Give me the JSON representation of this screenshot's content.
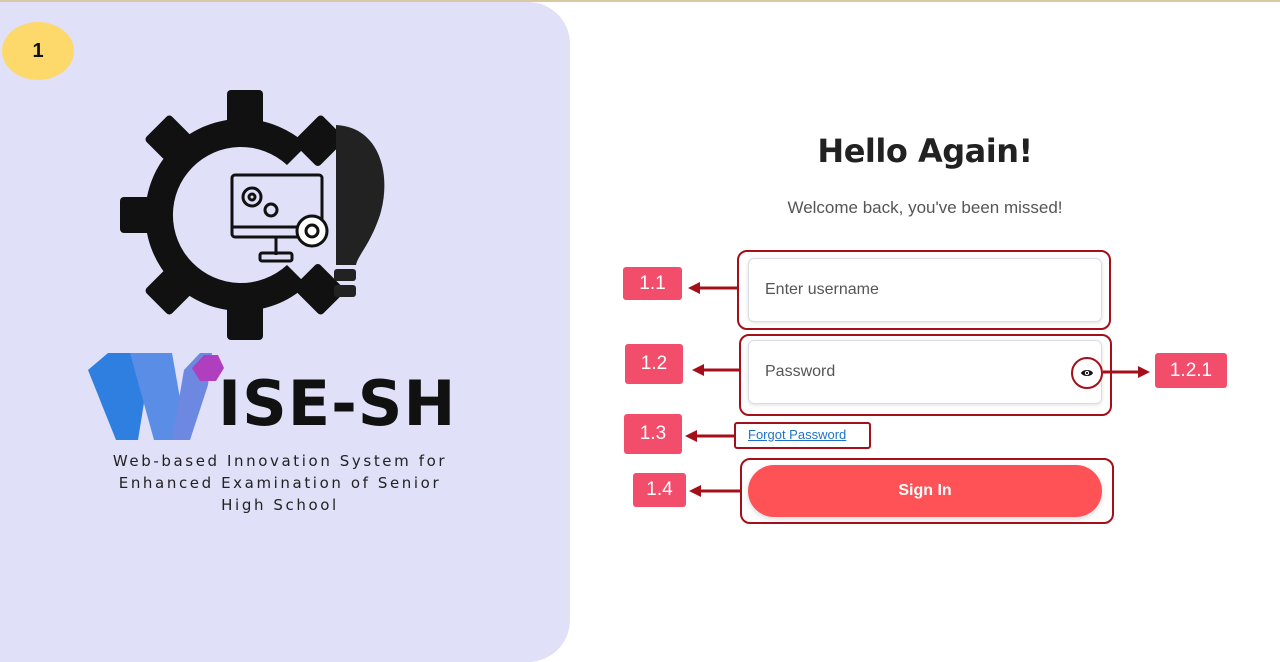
{
  "step_marker": "1",
  "branding": {
    "logo_text": "ISE-SHS",
    "tagline_line1": "Web-based Innovation System for",
    "tagline_line2": "Enhanced Examination of Senior",
    "tagline_line3": "High School"
  },
  "login": {
    "heading": "Hello Again!",
    "subheading": "Welcome back, you've been missed!",
    "username_placeholder": "Enter username",
    "password_placeholder": "Password",
    "forgot_password": "Forgot Password",
    "signin_label": "Sign In"
  },
  "annotations": {
    "username": "1.1",
    "password": "1.2",
    "password_toggle": "1.2.1",
    "forgot": "1.3",
    "signin": "1.4"
  },
  "colors": {
    "panel_bg": "#e0e0f8",
    "accent": "#ff5257",
    "annotation_badge": "#f24e6c",
    "annotation_frame": "#a40f1a",
    "marker": "#fdd96b"
  }
}
